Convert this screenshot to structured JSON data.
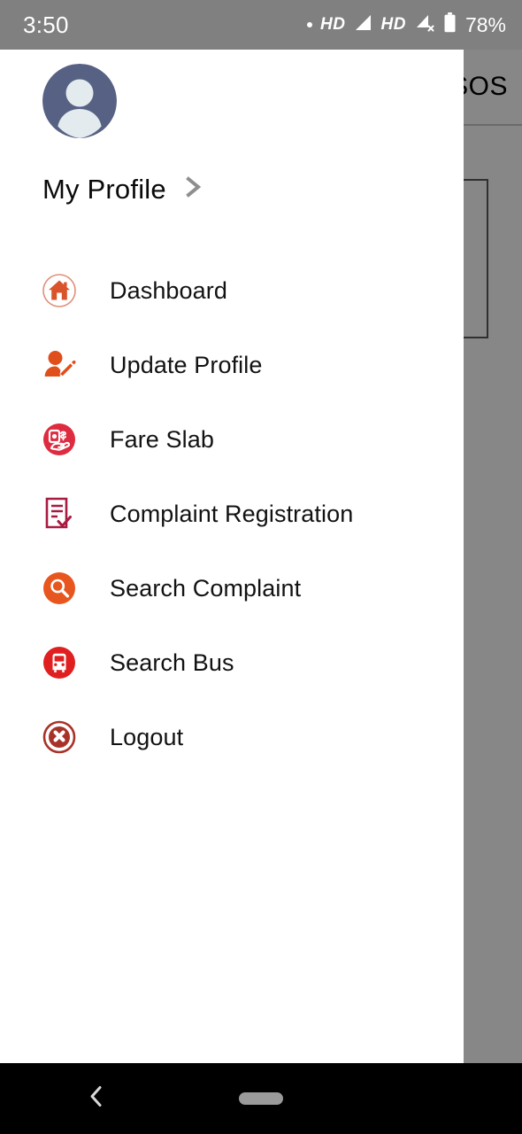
{
  "status_bar": {
    "time": "3:50",
    "battery_percent": "78%",
    "network_label_1": "HD",
    "network_label_2": "HD",
    "icons": [
      "dot-icon",
      "hd-label",
      "signal-bars-icon",
      "hd-label",
      "signal-no-service-icon",
      "battery-icon"
    ],
    "background_color": "#808080",
    "foreground_color": "#ffffff"
  },
  "background_app": {
    "appbar_title": "SOS"
  },
  "drawer": {
    "avatar": "default-user-avatar",
    "profile": {
      "label": "My Profile",
      "chevron": "chevron-right-icon"
    },
    "items": [
      {
        "label": "Dashboard",
        "icon": "home-icon",
        "color": "#D9542B"
      },
      {
        "label": "Update Profile",
        "icon": "user-edit-icon",
        "color": "#E04E1B"
      },
      {
        "label": "Fare Slab",
        "icon": "hand-money-icon",
        "color": "#DE2B3F"
      },
      {
        "label": "Complaint Registration",
        "icon": "document-check-icon",
        "color": "#A81B40"
      },
      {
        "label": "Search Complaint",
        "icon": "search-icon",
        "color": "#E8561F"
      },
      {
        "label": "Search Bus",
        "icon": "bus-icon",
        "color": "#E02020"
      },
      {
        "label": "Logout",
        "icon": "close-circle-icon",
        "color": "#A83228"
      }
    ],
    "background_color": "#ffffff"
  },
  "nav_bar": {
    "back": "back-chevron-icon",
    "home": "home-pill-indicator",
    "background_color": "#000000"
  }
}
